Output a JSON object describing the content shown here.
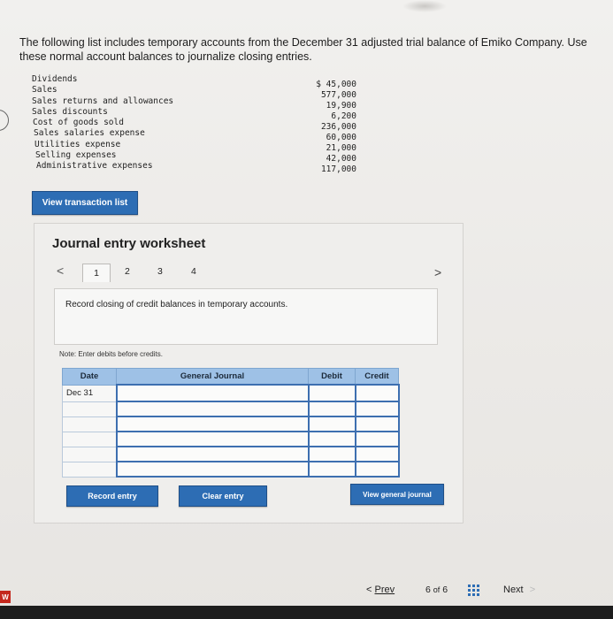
{
  "intro_text": "The following list includes temporary accounts from the December 31 adjusted trial balance of Emiko Company. Use these normal account balances to journalize closing entries.",
  "accounts": [
    {
      "name": "Dividends",
      "amount": "$ 45,000"
    },
    {
      "name": "Sales",
      "amount": "577,000"
    },
    {
      "name": "Sales returns and allowances",
      "amount": "19,900"
    },
    {
      "name": "Sales discounts",
      "amount": "6,200"
    },
    {
      "name": "Cost of goods sold",
      "amount": "236,000"
    },
    {
      "name": "Sales salaries expense",
      "amount": "60,000"
    },
    {
      "name": "Utilities expense",
      "amount": "21,000"
    },
    {
      "name": "Selling expenses",
      "amount": "42,000"
    },
    {
      "name": "Administrative expenses",
      "amount": "117,000"
    }
  ],
  "view_transaction_label": "View transaction list",
  "worksheet": {
    "title": "Journal entry worksheet",
    "pages": [
      "1",
      "2",
      "3",
      "4"
    ],
    "prev_arrow": "<",
    "next_arrow": ">",
    "instruction": "Record closing of credit balances in temporary accounts.",
    "note": "Note: Enter debits before credits.",
    "headers": {
      "date": "Date",
      "journal": "General Journal",
      "debit": "Debit",
      "credit": "Credit"
    },
    "rows": [
      {
        "date": "Dec 31",
        "account": "",
        "debit": "",
        "credit": ""
      },
      {
        "date": "",
        "account": "",
        "debit": "",
        "credit": ""
      },
      {
        "date": "",
        "account": "",
        "debit": "",
        "credit": ""
      },
      {
        "date": "",
        "account": "",
        "debit": "",
        "credit": ""
      },
      {
        "date": "",
        "account": "",
        "debit": "",
        "credit": ""
      },
      {
        "date": "",
        "account": "",
        "debit": "",
        "credit": ""
      }
    ],
    "record_label": "Record entry",
    "clear_label": "Clear entry",
    "view_journal_label": "View general journal"
  },
  "footer": {
    "prev_label": "Prev",
    "prev_arrow": "<",
    "page_current": "6",
    "page_of": "of",
    "page_total": "6",
    "next_label": "Next",
    "next_arrow": ">",
    "badge": "W"
  },
  "colors": {
    "accent": "#2d6db4",
    "header_blue": "#9ec1e6"
  },
  "icons": {
    "grid": "grid-icon"
  }
}
